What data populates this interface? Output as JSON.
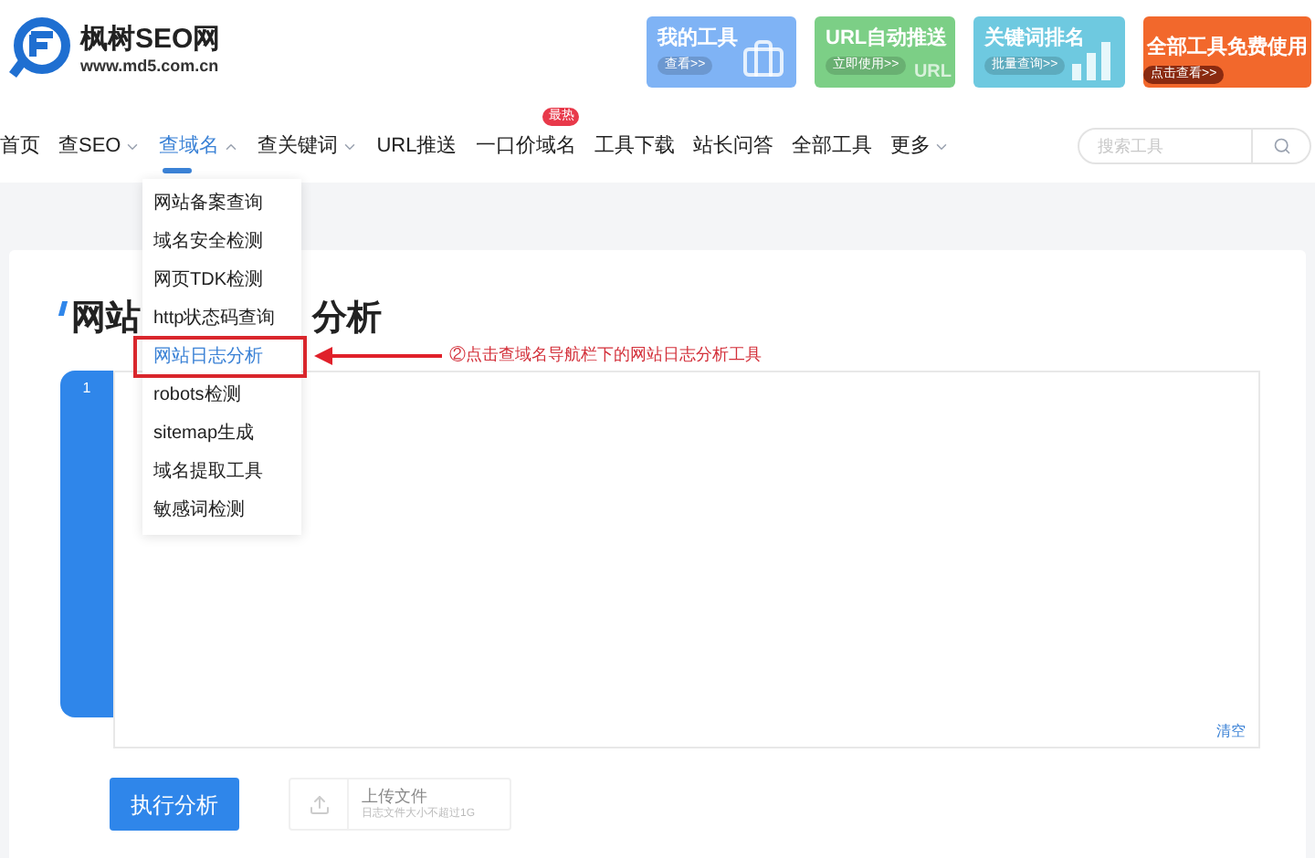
{
  "logo": {
    "name": "枫树SEO网",
    "url": "www.md5.com.cn"
  },
  "banners": [
    {
      "kind": "tools",
      "title": "我的工具",
      "action": "查看>>"
    },
    {
      "kind": "push",
      "title": "URL自动推送",
      "action": "立即使用>>",
      "art": "URL"
    },
    {
      "kind": "rank",
      "title": "关键词排名",
      "action": "批量查询>>"
    },
    {
      "kind": "promo",
      "title": "全部工具免费使用",
      "action": "点击查看>>"
    }
  ],
  "nav": [
    {
      "label": "首页",
      "selected": false,
      "has_menu": false
    },
    {
      "label": "查SEO",
      "selected": false,
      "has_menu": true
    },
    {
      "label": "查域名",
      "selected": true,
      "has_menu": true
    },
    {
      "label": "查关键词",
      "selected": false,
      "has_menu": true
    },
    {
      "label": "URL推送",
      "selected": false,
      "has_menu": false
    },
    {
      "label": "一口价域名",
      "selected": false,
      "has_menu": false,
      "badge": "最热"
    },
    {
      "label": "工具下载",
      "selected": false,
      "has_menu": false
    },
    {
      "label": "站长问答",
      "selected": false,
      "has_menu": false
    },
    {
      "label": "全部工具",
      "selected": false,
      "has_menu": false
    },
    {
      "label": "更多",
      "selected": false,
      "has_menu": true
    }
  ],
  "search": {
    "placeholder": "搜索工具"
  },
  "dropdown": [
    {
      "label": "网站备案查询",
      "selected": false
    },
    {
      "label": "域名安全检测",
      "selected": false
    },
    {
      "label": "网页TDK检测",
      "selected": false
    },
    {
      "label": "http状态码查询",
      "selected": false
    },
    {
      "label": "网站日志分析",
      "selected": true
    },
    {
      "label": "robots检测",
      "selected": false
    },
    {
      "label": "sitemap生成",
      "selected": false
    },
    {
      "label": "域名提取工具",
      "selected": false
    },
    {
      "label": "敏感词检测",
      "selected": false
    }
  ],
  "annotation": "②点击查域名导航栏下的网站日志分析工具",
  "title_visible": [
    "网站",
    "分析"
  ],
  "editor": {
    "line_number": "1",
    "clear": "清空"
  },
  "run_button": "执行分析",
  "upload": {
    "label": "上传文件",
    "hint": "日志文件大小不超过1G"
  }
}
